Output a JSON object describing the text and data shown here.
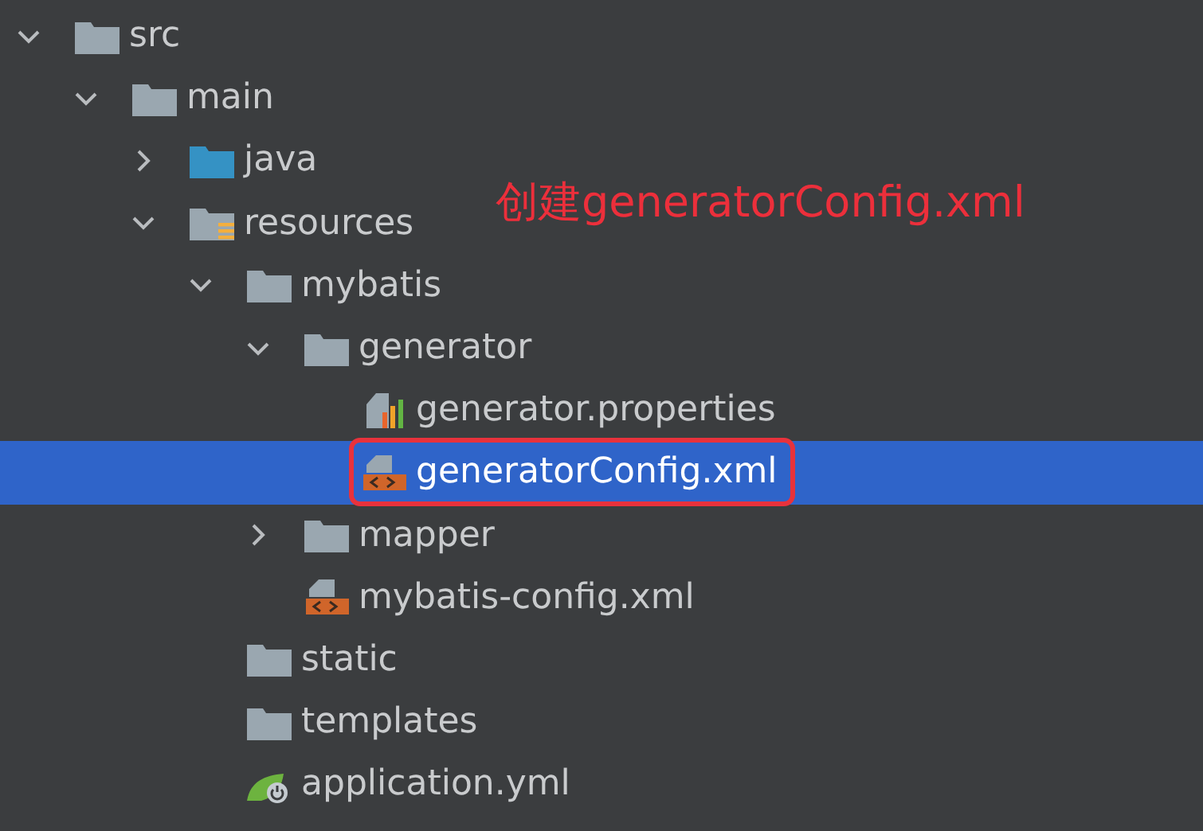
{
  "tree": [
    {
      "label": "src",
      "kind": "folder",
      "expanded": true,
      "selected": false,
      "children": [
        {
          "label": "main",
          "kind": "folder",
          "expanded": true,
          "selected": false,
          "children": [
            {
              "label": "java",
              "kind": "source-folder",
              "expanded": false,
              "selected": false
            },
            {
              "label": "resources",
              "kind": "resource-folder",
              "expanded": true,
              "selected": false,
              "children": [
                {
                  "label": "mybatis",
                  "kind": "folder",
                  "expanded": true,
                  "selected": false,
                  "children": [
                    {
                      "label": "generator",
                      "kind": "folder",
                      "expanded": true,
                      "selected": false,
                      "children": [
                        {
                          "label": "generator.properties",
                          "kind": "properties",
                          "selected": false,
                          "highlighted": false
                        },
                        {
                          "label": "generatorConfig.xml",
                          "kind": "xml",
                          "selected": true,
                          "highlighted": true
                        }
                      ]
                    },
                    {
                      "label": "mapper",
                      "kind": "folder",
                      "expanded": false,
                      "selected": false
                    },
                    {
                      "label": "mybatis-config.xml",
                      "kind": "xml",
                      "selected": false,
                      "highlighted": false
                    }
                  ]
                },
                {
                  "label": "static",
                  "kind": "folder",
                  "selected": false
                },
                {
                  "label": "templates",
                  "kind": "folder",
                  "selected": false
                },
                {
                  "label": "application.yml",
                  "kind": "spring-config",
                  "selected": false,
                  "highlighted": false
                }
              ]
            }
          ]
        }
      ]
    }
  ],
  "annotation": {
    "text": "创建generatorConfig.xml"
  }
}
